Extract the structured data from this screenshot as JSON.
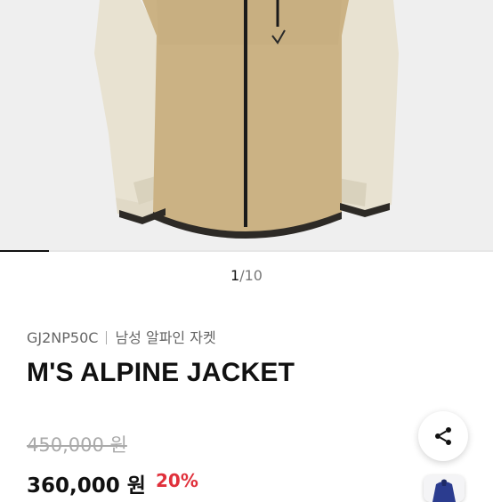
{
  "gallery": {
    "current": "1",
    "separator": "/",
    "total": "10",
    "progress_fraction": 0.1
  },
  "product": {
    "code": "GJ2NP50C",
    "category": "남성 알파인 자켓",
    "name": "M'S ALPINE JACKET",
    "original_price": "450,000 원",
    "sale_price": "360,000 원",
    "discount": "20%"
  },
  "colors": {
    "accent_discount": "#e0303b",
    "jacket_body": "#cbb284",
    "jacket_sleeve": "#e6e0cf"
  },
  "icons": {
    "share": "share-icon"
  }
}
